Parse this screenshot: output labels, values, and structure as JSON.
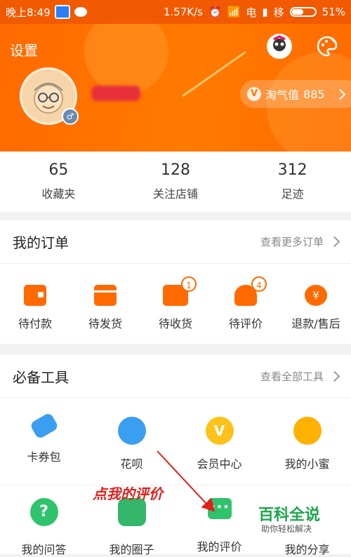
{
  "status": {
    "time": "晚上8:49",
    "speed": "1.57K/s",
    "carrier1": "电",
    "carrier2": "移",
    "battery": "51%"
  },
  "header": {
    "settings": "设置",
    "taoqi_label": "淘气值",
    "taoqi_value": "885"
  },
  "stats": [
    {
      "num": "65",
      "label": "收藏夹"
    },
    {
      "num": "128",
      "label": "关注店铺"
    },
    {
      "num": "312",
      "label": "足迹"
    }
  ],
  "orders": {
    "title": "我的订单",
    "more": "查看更多订单",
    "items": [
      {
        "label": "待付款",
        "badge": ""
      },
      {
        "label": "待发货",
        "badge": ""
      },
      {
        "label": "待收货",
        "badge": "1"
      },
      {
        "label": "待评价",
        "badge": "4"
      },
      {
        "label": "退款/售后",
        "badge": ""
      }
    ]
  },
  "tools": {
    "title": "必备工具",
    "more": "查看全部工具",
    "row1": [
      {
        "label": "卡券包",
        "icon": "ticket-icon"
      },
      {
        "label": "花呗",
        "icon": "huabei-icon"
      },
      {
        "label": "会员中心",
        "icon": "vip-icon"
      },
      {
        "label": "我的小蜜",
        "icon": "bee-icon"
      }
    ],
    "row2": [
      {
        "label": "我的问答",
        "icon": "question-icon"
      },
      {
        "label": "我的圈子",
        "icon": "circle-icon"
      },
      {
        "label": "我的评价",
        "icon": "comment-icon"
      },
      {
        "label": "我的分享",
        "icon": "share-icon"
      }
    ]
  },
  "annotation": {
    "text": "点我的评价"
  },
  "watermark": {
    "title": "百科全说",
    "subtitle": "助你轻松解决"
  },
  "colors": {
    "accent": "#ff6a00",
    "annotation": "#e0201a"
  }
}
